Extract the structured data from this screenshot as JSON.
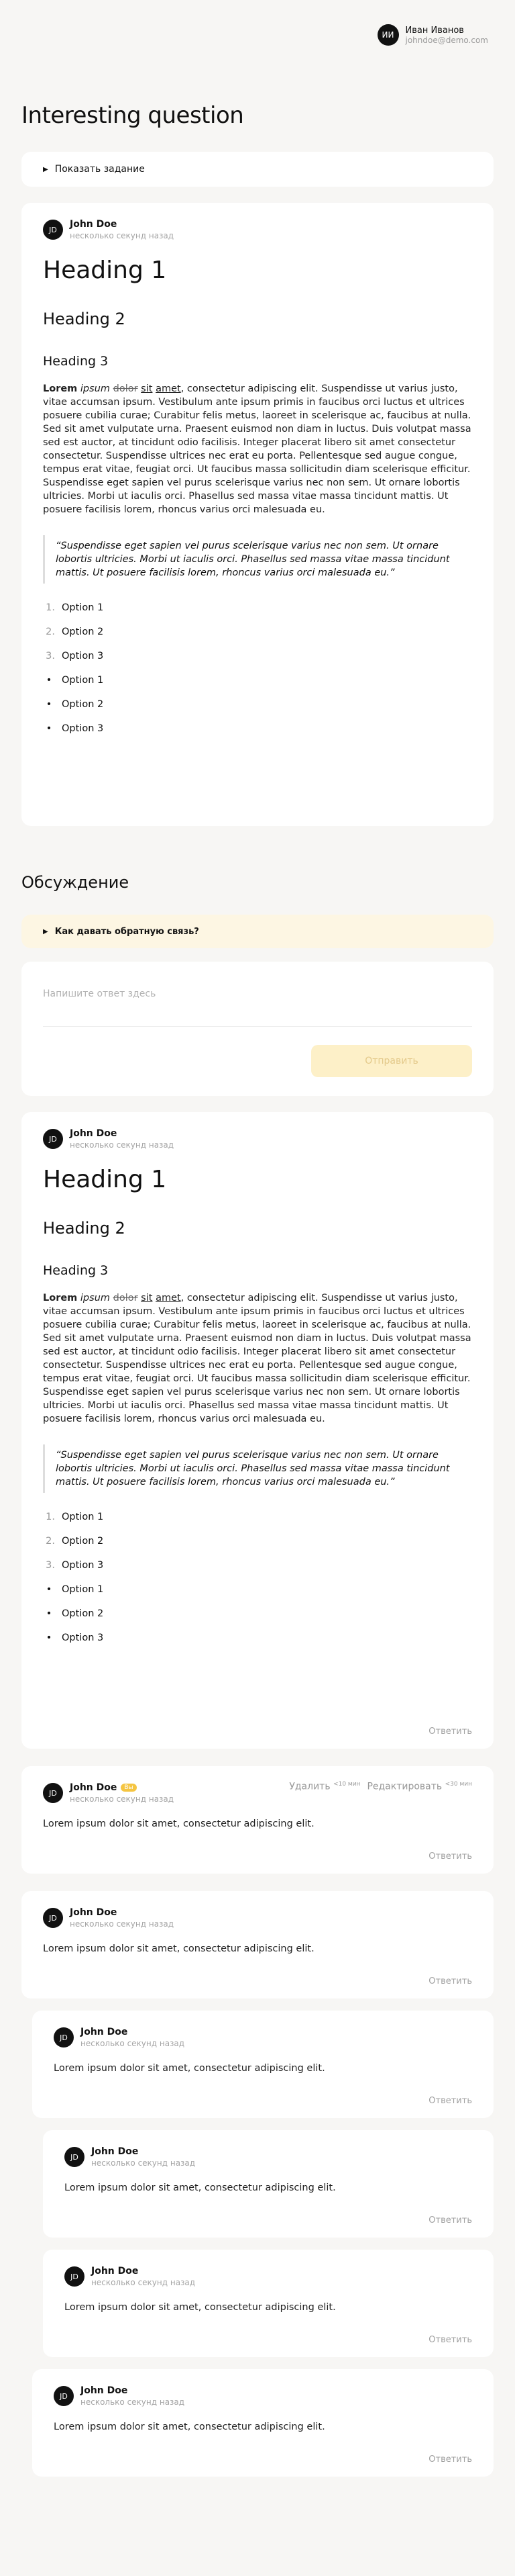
{
  "user": {
    "initials": "ИИ",
    "name": "Иван Иванов",
    "email": "johndoe@demo.com"
  },
  "page_title": "Interesting question",
  "show_task": "Показать задание",
  "post": {
    "author": "John Doe",
    "avatar": "JD",
    "time": "несколько секунд назад",
    "h1": "Heading 1",
    "h2": "Heading 2",
    "h3": "Heading 3",
    "p_bold": "Lorem",
    "p_italic": "ipsum",
    "p_strike": "dolor",
    "p_under1": "sit",
    "p_under2": "amet",
    "paragraph": ", consectetur adipiscing elit. Suspendisse ut varius justo, vitae accumsan ipsum. Vestibulum ante ipsum primis in faucibus orci luctus et ultrices posuere cubilia curae; Curabitur felis metus, laoreet in scelerisque ac, faucibus at nulla. Sed sit amet vulputate urna. Praesent euismod non diam in luctus. Duis volutpat massa sed est auctor, at tincidunt odio facilisis. Integer placerat libero sit amet consectetur consectetur. Suspendisse ultrices nec erat eu porta. Pellentesque sed augue congue, tempus erat vitae, feugiat orci. Ut faucibus massa sollicitudin diam scelerisque efficitur. Suspendisse eget sapien vel purus scelerisque varius nec non sem. Ut ornare lobortis ultricies. Morbi ut iaculis orci. Phasellus sed massa vitae massa tincidunt mattis. Ut posuere facilisis lorem, rhoncus varius orci malesuada eu.",
    "quote": "“Suspendisse eget sapien vel purus scelerisque varius nec non sem. Ut ornare lobortis ultricies. Morbi ut iaculis orci. Phasellus sed massa vitae massa tincidunt mattis. Ut posuere facilisis lorem, rhoncus varius orci malesuada eu.”",
    "ordered": [
      "Option 1",
      "Option 2",
      "Option 3"
    ],
    "ordered_nums": [
      "1.",
      "2.",
      "3."
    ],
    "bullets": [
      "Option 1",
      "Option 2",
      "Option 3"
    ]
  },
  "discussion_title": "Обсуждение",
  "feedback_label": "Как давать обратную связь?",
  "composer": {
    "placeholder": "Напишите ответ здесь",
    "send": "Отправить"
  },
  "reply": "Ответить",
  "comment_text": "Lorem ipsum dolor sit amet, consectetur adipiscing elit.",
  "own_actions": {
    "delete": "Удалить",
    "delete_time": "<10 мин",
    "edit": "Редактировать",
    "edit_time": "<30 мин",
    "badge": "Вы"
  }
}
